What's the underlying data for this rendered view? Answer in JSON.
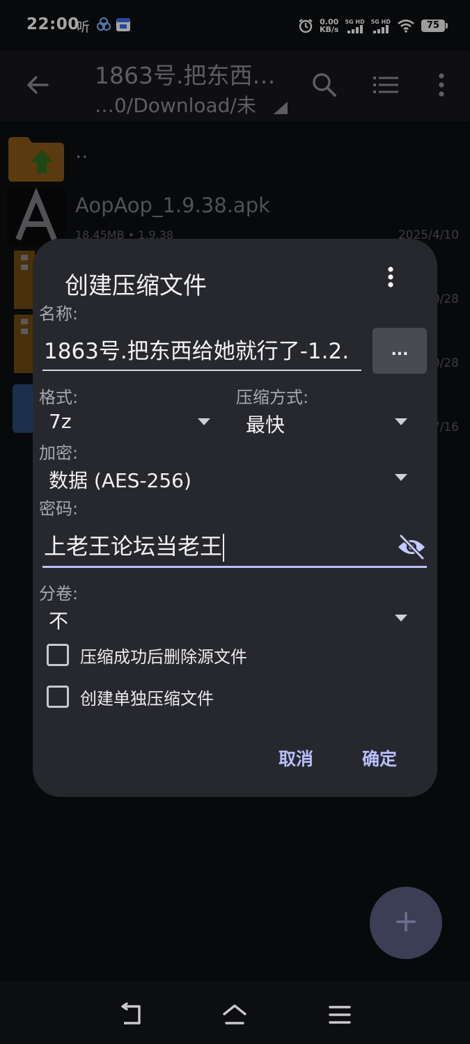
{
  "status": {
    "time": "22:00",
    "left_extra": "听",
    "net_speed_value": "0.00",
    "net_speed_unit": "KB/s",
    "sig1_label": "5G HD",
    "sig2_label": "5G HD",
    "battery": "75"
  },
  "toolbar": {
    "title": "1863号.把东西…",
    "path": "…0/Download/未"
  },
  "files": [
    {
      "name": "..",
      "meta": "",
      "date": ""
    },
    {
      "name": "AopAop_1.9.38.apk",
      "meta": "18.45MB  • 1.9.38",
      "date": "2025/4/10"
    },
    {
      "name": "",
      "meta": "",
      "date": "0/28"
    },
    {
      "name": "",
      "meta": "",
      "date": "0/28"
    },
    {
      "name": "",
      "meta": "",
      "date": "7/16"
    }
  ],
  "dialog": {
    "title": "创建压缩文件",
    "name_label": "名称:",
    "name_value": "1863号.把东西给她就行了-1.2.",
    "browse_label": "...",
    "format_label": "格式:",
    "format_value": "7z",
    "method_label": "压缩方式:",
    "method_value": "最快",
    "encrypt_label": "加密:",
    "encrypt_value": "数据 (AES-256)",
    "password_label": "密码:",
    "password_value": "上老王论坛当老王",
    "split_label": "分卷:",
    "split_value": "不",
    "delete_source_label": "压缩成功后删除源文件",
    "separate_label": "创建单独压缩文件",
    "cancel_label": "取消",
    "ok_label": "确定"
  },
  "fab": {
    "label": "+"
  },
  "colors": {
    "accent": "#bcc2ff",
    "dialog_bg": "#27282d",
    "toolbar_bg": "#17181c"
  }
}
